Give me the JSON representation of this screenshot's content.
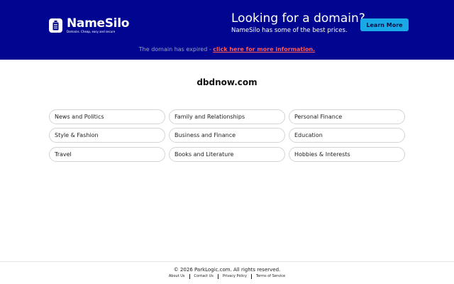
{
  "banner": {
    "logo": {
      "name": "NameSilo",
      "tagline": "Domains. Cheap, easy and secure"
    },
    "headline": "Looking for a domain?",
    "subline": "NameSilo has some of the best prices.",
    "cta_label": "Learn More",
    "expired_notice": "The domain has expired - ",
    "expired_link": "click here for more information."
  },
  "domain": "dbdnow.com",
  "categories": [
    "News and Politics",
    "Family and Relationships",
    "Personal Finance",
    "Style & Fashion",
    "Business and Finance",
    "Education",
    "Travel",
    "Books and Literature",
    "Hobbies & Interests"
  ],
  "footer": {
    "copyright": "© 2026 ParkLogic.com. All rights reserved.",
    "links": [
      "About Us",
      "Contact Us",
      "Privacy Policy",
      "Terms of Service"
    ]
  },
  "colors": {
    "banner_bg": "#00068f",
    "cta_bg": "#18a9e6",
    "link": "#ff5a5a"
  }
}
